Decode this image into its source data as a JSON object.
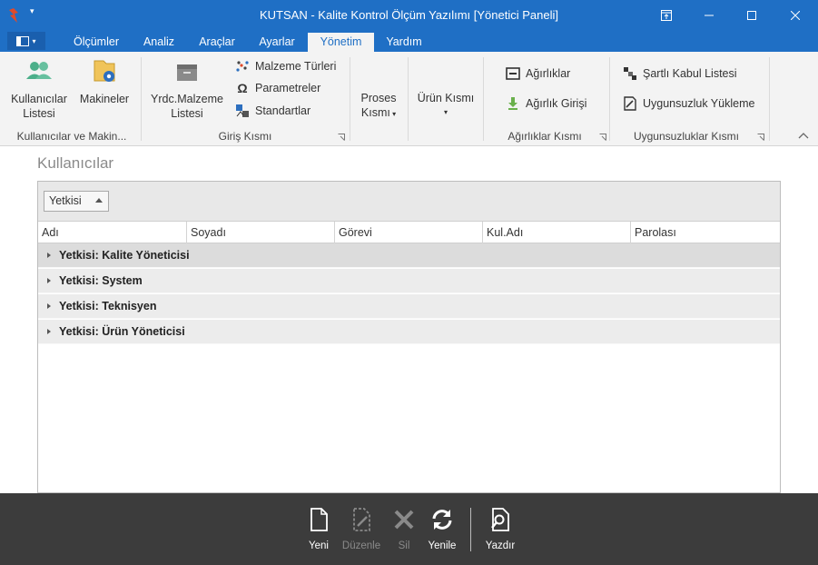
{
  "window": {
    "title": "KUTSAN - Kalite Kontrol Ölçüm Yazılımı [Yönetici Paneli]",
    "colors": {
      "titlebar": "#1f6fc5",
      "accent": "#1f6fc5",
      "actionbar": "#3c3c3c"
    }
  },
  "tabs": [
    {
      "label": "Ölçümler",
      "active": false
    },
    {
      "label": "Analiz",
      "active": false
    },
    {
      "label": "Araçlar",
      "active": false
    },
    {
      "label": "Ayarlar",
      "active": false
    },
    {
      "label": "Yönetim",
      "active": true
    },
    {
      "label": "Yardım",
      "active": false
    }
  ],
  "ribbon": {
    "groups": {
      "users_machines": {
        "label": "Kullanıcılar ve Makin...",
        "users_btn": {
          "line1": "Kullanıcılar",
          "line2": "Listesi",
          "icon": "users-icon"
        },
        "machines_btn": {
          "label": "Makineler",
          "icon": "machines-icon"
        }
      },
      "input": {
        "label": "Giriş Kısmı",
        "yrdc_btn": {
          "line1": "Yrdc.Malzeme",
          "line2": "Listesi",
          "icon": "box-icon"
        },
        "material_types": "Malzeme Türleri",
        "parameters": "Parametreler",
        "standards": "Standartlar"
      },
      "process": {
        "line1": "Proses",
        "line2": "Kısmı"
      },
      "product": {
        "line1": "Ürün Kısmı"
      },
      "weights": {
        "label": "Ağırlıklar Kısmı",
        "weights": "Ağırlıklar",
        "weight_entry": "Ağırlık Girişi"
      },
      "nonconformity": {
        "label": "Uygunsuzluklar Kısmı",
        "conditional": "Şartlı Kabul Listesi",
        "upload": "Uygunsuzluk Yükleme"
      }
    }
  },
  "main": {
    "title": "Kullanıcılar",
    "group_chip": "Yetkisi",
    "columns": [
      "Adı",
      "Soyadı",
      "Görevi",
      "Kul.Adı",
      "Parolası"
    ],
    "groups": [
      {
        "label": "Yetkisi: Kalite Yöneticisi",
        "selected": true
      },
      {
        "label": "Yetkisi: System",
        "selected": false
      },
      {
        "label": "Yetkisi: Teknisyen",
        "selected": false
      },
      {
        "label": "Yetkisi: Ürün Yöneticisi",
        "selected": false
      }
    ]
  },
  "actions": {
    "new": "Yeni",
    "edit": "Düzenle",
    "delete": "Sil",
    "refresh": "Yenile",
    "print": "Yazdır"
  }
}
